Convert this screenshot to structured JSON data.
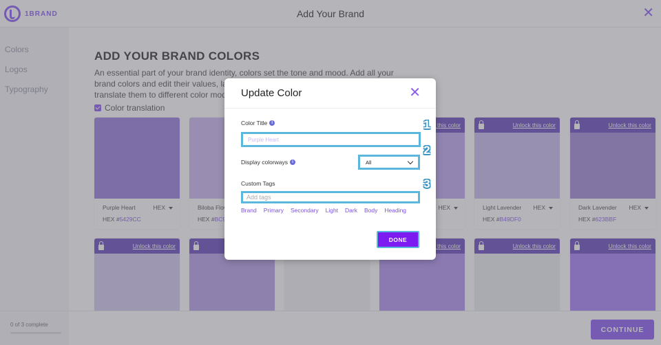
{
  "app": {
    "logo_text": "1BRAND",
    "window_title": "Add Your Brand"
  },
  "sidebar": {
    "items": [
      {
        "label": "Colors"
      },
      {
        "label": "Logos"
      },
      {
        "label": "Typography"
      }
    ]
  },
  "main": {
    "heading": "ADD YOUR BRAND COLORS",
    "description": "An essential part of your brand identity, colors set the tone and mood. Add all your brand colors and edit their values, label them, tag them, and automatically translate them to different color models.",
    "translation_label": "Color translation"
  },
  "cards_row1": [
    {
      "name": "Purple Heart",
      "model": "HEX",
      "hex_prefix": "HEX #",
      "hex": "5429CC",
      "color": "#9b7fe0",
      "locked": false
    },
    {
      "name": "Biloba Flower",
      "model": "HEX",
      "hex_prefix": "HEX #",
      "hex": "BC9",
      "color": "#ccb8f0",
      "locked": false
    },
    {
      "name": "",
      "model": "",
      "hex_prefix": "",
      "hex": "",
      "color": "#f1f1f4",
      "locked": false
    },
    {
      "name": "",
      "model": "HEX",
      "hex_prefix": "",
      "hex": "",
      "color": "#c1a8f2",
      "locked": true,
      "unlock_label": "Unlock this color"
    },
    {
      "name": "Light Lavender",
      "model": "HEX",
      "hex_prefix": "HEX #",
      "hex": "B49DF0",
      "color": "#cbbcf0",
      "locked": true,
      "unlock_label": "Unlock this color"
    },
    {
      "name": "Dark Lavender",
      "model": "HEX",
      "hex_prefix": "HEX #",
      "hex": "623BBF",
      "color": "#a28ad8",
      "locked": true,
      "unlock_label": "Unlock this color"
    }
  ],
  "cards_row2": [
    {
      "color": "#d6c8f0",
      "locked": true,
      "unlock_label": "Unlock this color"
    },
    {
      "color": "#b9a1ea",
      "locked": true,
      "unlock_label": ""
    },
    {
      "color": "#f1f1f4",
      "locked": false,
      "unlock_label": ""
    },
    {
      "color": "#b294f0",
      "locked": true,
      "unlock_label": "Unlock this color"
    },
    {
      "color": "#ececf0",
      "locked": true,
      "unlock_label": "Unlock this color"
    },
    {
      "color": "#a882f8",
      "locked": true,
      "unlock_label": "Unlock this color"
    }
  ],
  "footer": {
    "progress_text": "0 of 3 complete",
    "progress": 0.0,
    "continue_label": "CONTINUE"
  },
  "modal": {
    "title": "Update Color",
    "color_title_label": "Color Title",
    "color_title_placeholder": "Purple Heart",
    "colorways_label": "Display colorways",
    "colorways_value": "All",
    "tags_label": "Custom Tags",
    "tags_placeholder": "Add tags",
    "tags": [
      "Brand",
      "Primary",
      "Secondary",
      "Light",
      "Dark",
      "Body",
      "Heading"
    ],
    "done_label": "DONE",
    "badges": [
      "1",
      "2",
      "3"
    ]
  },
  "colors": {
    "accent": "#8a5cf0",
    "highlight": "#5bb8dc",
    "done_button": "#7c1cf0"
  }
}
